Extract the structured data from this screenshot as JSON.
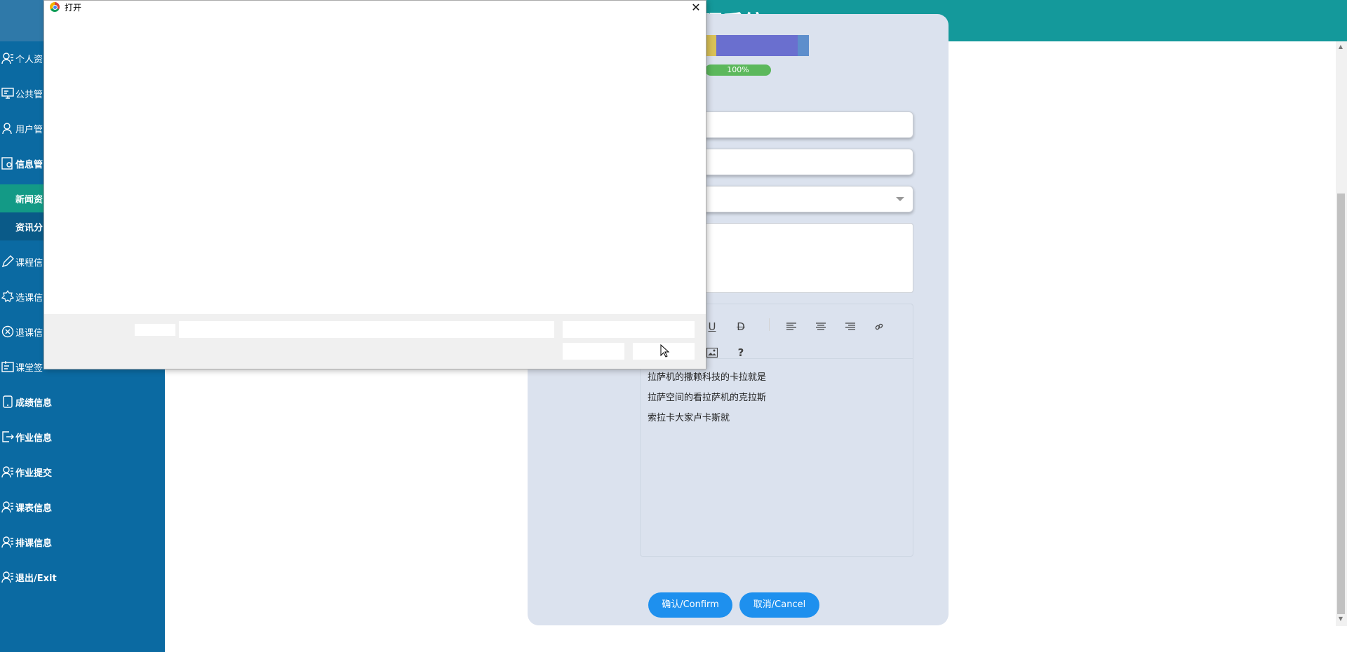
{
  "header": {
    "title": "理系统"
  },
  "sidebar": {
    "items": [
      {
        "label": "个人资",
        "icon": "person-icon"
      },
      {
        "label": "公共管",
        "icon": "monitor-icon"
      },
      {
        "label": "用户管",
        "icon": "user-icon"
      },
      {
        "label": "信息管",
        "icon": "info-settings-icon"
      },
      {
        "label": "课程信",
        "icon": "edit-icon"
      },
      {
        "label": "选课信",
        "icon": "badge-icon"
      },
      {
        "label": "退课信",
        "icon": "cancel-circle-icon"
      },
      {
        "label": "课堂签",
        "icon": "checkin-icon"
      },
      {
        "label": "成绩信息",
        "icon": "tablet-icon"
      },
      {
        "label": "作业信息",
        "icon": "exit-box-icon"
      },
      {
        "label": "作业提交",
        "icon": "person-list-icon"
      },
      {
        "label": "课表信息",
        "icon": "person-list-icon"
      },
      {
        "label": "排课信息",
        "icon": "person-list-icon"
      },
      {
        "label": "退出/Exit",
        "icon": "person-list-icon"
      }
    ],
    "subitems": [
      {
        "label": "新闻资",
        "active": true
      },
      {
        "label": "资讯分",
        "active": false
      }
    ]
  },
  "form": {
    "progress": "100%",
    "editor_lines": [
      "拉萨机的撒赖科技的卡拉就是",
      "拉萨空间的看拉萨机的克拉斯",
      "索拉卡大家卢卡斯就"
    ],
    "toolbar": [
      "underline",
      "strikethrough",
      "align-left",
      "align-center",
      "align-right",
      "link",
      "image",
      "help"
    ],
    "confirm_label": "确认/Confirm",
    "cancel_label": "取消/Cancel",
    "help_glyph": "?"
  },
  "dialog": {
    "title": "打开",
    "close_glyph": "✕"
  },
  "colors": {
    "header": "#14999b",
    "sidebar": "#0b6aa2",
    "active_sub": "#139a86",
    "panel": "#dbe2ee",
    "button": "#1e90ee",
    "progress": "#5cb85c"
  }
}
